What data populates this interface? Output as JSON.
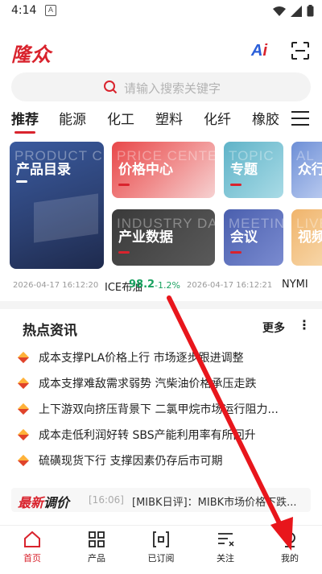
{
  "status_bar": {
    "time": "4:14",
    "notification_glyph": "A"
  },
  "header": {
    "logo": "隆众",
    "ai_label_a": "A",
    "ai_label_i": "i"
  },
  "search": {
    "placeholder": "请输入搜索关键字"
  },
  "tabs": [
    {
      "label": "推荐",
      "active": true
    },
    {
      "label": "能源"
    },
    {
      "label": "化工"
    },
    {
      "label": "塑料"
    },
    {
      "label": "化纤"
    },
    {
      "label": "橡胶"
    }
  ],
  "cards": {
    "product": {
      "label": "产品目录",
      "bg_word": "PRODUCT C"
    },
    "price": {
      "label": "价格中心",
      "bg_word": "PRICE CENTE"
    },
    "topic": {
      "label": "专题",
      "bg_word": "TOPIC"
    },
    "group": {
      "label": "众行",
      "bg_word": "AL"
    },
    "industry": {
      "label": "产业数据",
      "bg_word": "INDUSTRY DA"
    },
    "meeting": {
      "label": "会议",
      "bg_word": "MEETIN"
    },
    "video": {
      "label": "视频",
      "bg_word": "LIVE"
    }
  },
  "ticker": {
    "time1": "2026-04-17 16:12:20",
    "name1": "ICE布油",
    "value1": "98.2",
    "change1": "-1.2%",
    "time2": "2026-04-17 16:12:21",
    "name2": "NYMI"
  },
  "news": {
    "title": "热点资讯",
    "more": "更多",
    "more_icon": "⋮",
    "items": [
      "成本支撑PLA价格上行 市场逐步跟进调整",
      "成本支撑难敌需求弱势 汽柴油价格承压走跌",
      "上下游双向挤压背景下 二氯甲烷市场运行阻力...",
      "成本走低利润好转 SBS产能利用率有所回升",
      "硫磺现货下行 支撑因素仍存后市可期"
    ]
  },
  "price_adjust": {
    "brand_red": "最新",
    "brand_dark": "调价",
    "time": "[16:06]",
    "message": "[MIBK日评]：MIBK市场价格下跌..."
  },
  "nav": [
    {
      "label": "首页",
      "icon": "home-icon",
      "active": true
    },
    {
      "label": "产品",
      "icon": "grid-icon"
    },
    {
      "label": "已订阅",
      "icon": "subscribe-icon"
    },
    {
      "label": "关注",
      "icon": "follow-icon"
    },
    {
      "label": "我的",
      "icon": "user-icon"
    }
  ],
  "colors": {
    "brand_red": "#d9232d",
    "ai_blue": "#2b5fd9",
    "up_green": "#1aa260"
  }
}
